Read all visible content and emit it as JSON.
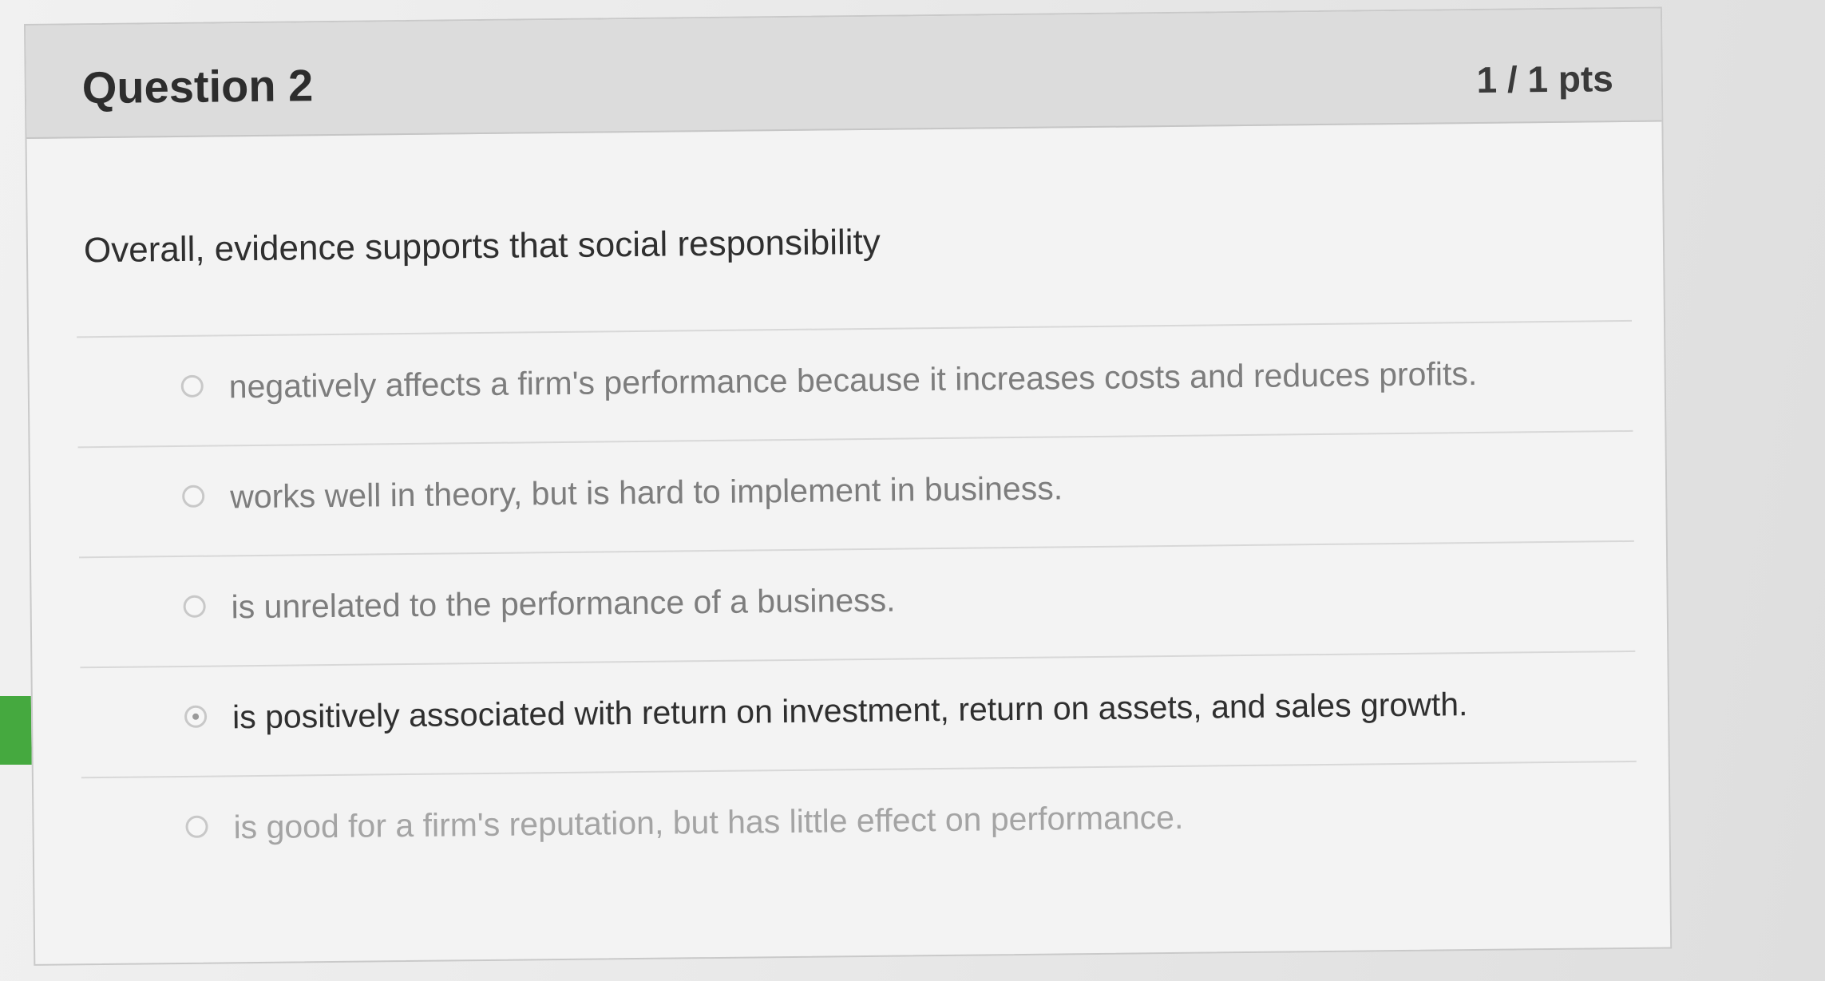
{
  "question": {
    "title": "Question 2",
    "points": "1 / 1 pts",
    "text": "Overall, evidence supports that social responsibility"
  },
  "answers": [
    {
      "label": "negatively affects a firm's performance because it increases costs and reduces profits.",
      "selected": false
    },
    {
      "label": "works well in theory, but is hard to implement in business.",
      "selected": false
    },
    {
      "label": "is unrelated to the performance of a business.",
      "selected": false
    },
    {
      "label": "is positively associated with return on investment, return on assets, and sales growth.",
      "selected": true
    },
    {
      "label": "is good for a firm's reputation, but has little effect on performance.",
      "selected": false
    }
  ],
  "colors": {
    "correct_flag": "#45a93f",
    "header_bg": "#dcdcdc"
  }
}
